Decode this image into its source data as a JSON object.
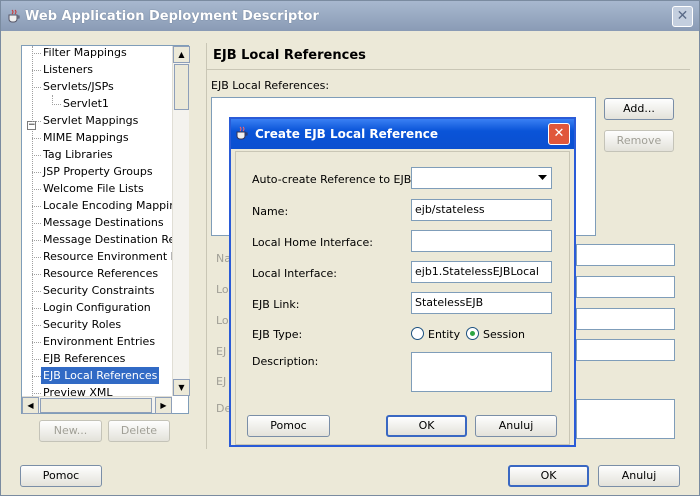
{
  "window": {
    "title": "Web Application Deployment Descriptor"
  },
  "tree": {
    "items": [
      {
        "label": "Filter Mappings",
        "sub": false
      },
      {
        "label": "Listeners",
        "sub": false
      },
      {
        "label": "Servlets/JSPs",
        "sub": false
      },
      {
        "label": "Servlet1",
        "sub": true
      },
      {
        "label": "Servlet Mappings",
        "sub": false
      },
      {
        "label": "MIME Mappings",
        "sub": false
      },
      {
        "label": "Tag Libraries",
        "sub": false
      },
      {
        "label": "JSP Property Groups",
        "sub": false
      },
      {
        "label": "Welcome File Lists",
        "sub": false
      },
      {
        "label": "Locale Encoding Mapping L",
        "sub": false
      },
      {
        "label": "Message Destinations",
        "sub": false
      },
      {
        "label": "Message Destination Refs",
        "sub": false
      },
      {
        "label": "Resource Environment Ref",
        "sub": false
      },
      {
        "label": "Resource References",
        "sub": false
      },
      {
        "label": "Security Constraints",
        "sub": false
      },
      {
        "label": "Login Configuration",
        "sub": false
      },
      {
        "label": "Security Roles",
        "sub": false
      },
      {
        "label": "Environment Entries",
        "sub": false
      },
      {
        "label": "EJB References",
        "sub": false
      },
      {
        "label": "EJB Local References",
        "sub": false,
        "selected": true
      },
      {
        "label": "Preview XML",
        "sub": false
      }
    ],
    "new_label": "New...",
    "delete_label": "Delete"
  },
  "panel": {
    "title": "EJB Local References",
    "list_label": "EJB Local References:",
    "add_label": "Add...",
    "remove_label": "Remove",
    "hidden_labels": [
      "Na",
      "Lo",
      "Lo",
      "EJ",
      "EJ",
      "De"
    ]
  },
  "modal": {
    "title": "Create EJB Local Reference",
    "auto_create_label": "Auto-create Reference to EJB:",
    "auto_create_value": "",
    "name_label": "Name:",
    "name_value": "ejb/stateless",
    "local_home_label": "Local Home Interface:",
    "local_home_value": "",
    "local_interface_label": "Local Interface:",
    "local_interface_value": "ejb1.StatelessEJBLocal",
    "ejb_link_label": "EJB Link:",
    "ejb_link_value": "StatelessEJB",
    "ejb_type_label": "EJB Type:",
    "ejb_type_options": [
      "Entity",
      "Session"
    ],
    "ejb_type_selected": "Session",
    "description_label": "Description:",
    "help_label": "Pomoc",
    "ok_label": "OK",
    "cancel_label": "Anuluj"
  },
  "footer": {
    "help_label": "Pomoc",
    "ok_label": "OK",
    "cancel_label": "Anuluj"
  }
}
